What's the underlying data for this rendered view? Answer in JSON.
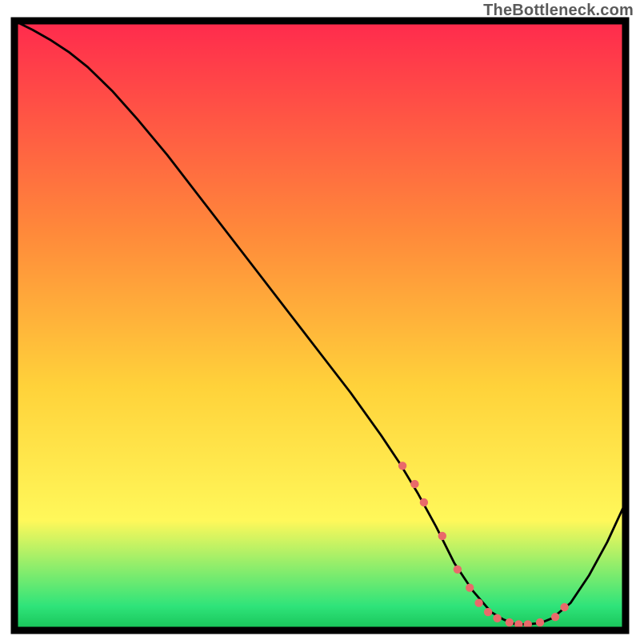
{
  "watermark": "TheBottleneck.com",
  "colors": {
    "frame_stroke": "#000000",
    "curve_stroke": "#000000",
    "dot_fill": "#e96a6a",
    "grad_top": "#ff2a4d",
    "grad_mid1": "#ff8a3a",
    "grad_mid2": "#ffd23a",
    "grad_mid3": "#fff85a",
    "grad_bottom": "#2fe47a",
    "grad_bottom_edge": "#17c257"
  },
  "chart_data": {
    "type": "line",
    "title": "",
    "xlabel": "",
    "ylabel": "",
    "xlim": [
      0,
      100
    ],
    "ylim": [
      0,
      100
    ],
    "series": [
      {
        "name": "bottleneck-curve",
        "x": [
          0,
          3,
          6,
          9,
          12,
          16,
          20,
          25,
          30,
          35,
          40,
          45,
          50,
          55,
          60,
          63,
          66,
          69,
          72,
          75,
          78,
          80,
          82,
          84,
          86,
          88,
          91,
          94,
          97,
          100
        ],
        "y": [
          100,
          98.5,
          96.8,
          94.8,
          92.4,
          88.5,
          84.0,
          78.0,
          71.5,
          65.0,
          58.5,
          52.0,
          45.5,
          39.0,
          32.0,
          27.5,
          22.5,
          17.0,
          11.0,
          6.5,
          3.0,
          1.8,
          1.0,
          1.0,
          1.2,
          2.0,
          4.5,
          9.0,
          14.5,
          21.0
        ]
      }
    ],
    "dots": {
      "name": "highlight-region",
      "x": [
        63.5,
        65.5,
        67.0,
        70.0,
        72.5,
        74.5,
        76.0,
        77.5,
        79.0,
        81.0,
        82.5,
        84.0,
        86.0,
        88.5,
        90.0
      ],
      "y": [
        27.0,
        24.0,
        21.0,
        15.5,
        10.0,
        7.0,
        4.5,
        3.0,
        2.0,
        1.3,
        1.0,
        1.0,
        1.3,
        2.2,
        3.8
      ]
    }
  }
}
